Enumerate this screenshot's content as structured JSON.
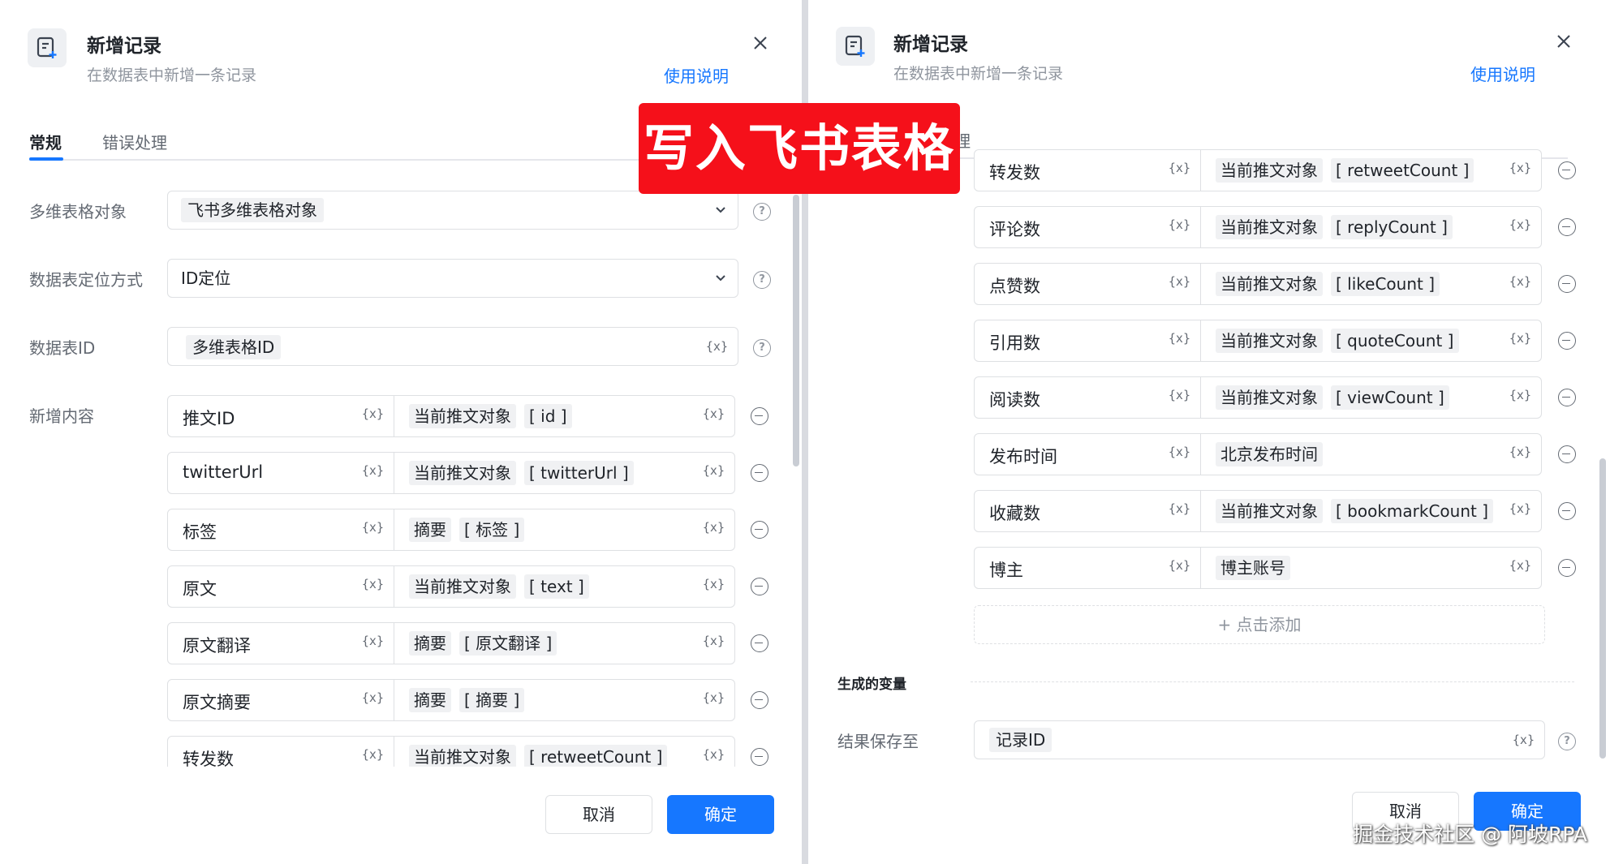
{
  "left": {
    "title": "新增记录",
    "subtitle": "在数据表中新增一条记录",
    "help_link": "使用说明",
    "tabs": [
      {
        "label": "常规"
      },
      {
        "label": "错误处理"
      }
    ],
    "fields": {
      "table_object": {
        "label": "多维表格对象",
        "value": "飞书多维表格对象"
      },
      "locate_method": {
        "label": "数据表定位方式",
        "value": "ID定位"
      },
      "table_id": {
        "label": "数据表ID",
        "value": "多维表格ID"
      },
      "new_content": {
        "label": "新增内容"
      }
    },
    "rows": [
      {
        "name": "推文ID",
        "source": "当前推文对象",
        "key": "id"
      },
      {
        "name": "twitterUrl",
        "source": "当前推文对象",
        "key": "twitterUrl"
      },
      {
        "name": "标签",
        "source": "摘要",
        "key": "标签"
      },
      {
        "name": "原文",
        "source": "当前推文对象",
        "key": "text"
      },
      {
        "name": "原文翻译",
        "source": "摘要",
        "key": "原文翻译"
      },
      {
        "name": "原文摘要",
        "source": "摘要",
        "key": "摘要"
      },
      {
        "name": "转发数",
        "source": "当前推文对象",
        "key": "retweetCount"
      }
    ],
    "cancel": "取消",
    "ok": "确定"
  },
  "right": {
    "title": "新增记录",
    "subtitle": "在数据表中新增一条记录",
    "help_link": "使用说明",
    "tab_partial": "理",
    "rows": [
      {
        "name": "转发数",
        "source": "当前推文对象",
        "key": "retweetCount"
      },
      {
        "name": "评论数",
        "source": "当前推文对象",
        "key": "replyCount"
      },
      {
        "name": "点赞数",
        "source": "当前推文对象",
        "key": "likeCount"
      },
      {
        "name": "引用数",
        "source": "当前推文对象",
        "key": "quoteCount"
      },
      {
        "name": "阅读数",
        "source": "当前推文对象",
        "key": "viewCount"
      },
      {
        "name": "发布时间",
        "source": "北京发布时间",
        "key": ""
      },
      {
        "name": "收藏数",
        "source": "当前推文对象",
        "key": "bookmarkCount"
      },
      {
        "name": "博主",
        "source": "博主账号",
        "key": ""
      }
    ],
    "add_label": "+ 点击添加",
    "section_title": "生成的变量",
    "result_label": "结果保存至",
    "result_value": "记录ID",
    "cancel": "取消",
    "ok": "确定"
  },
  "banner": "写入飞书表格",
  "watermark": "掘金技术社区 @ 阿坡RPA",
  "var_symbol": "{x}",
  "help_symbol": "?",
  "colors": {
    "accent": "#1677ff",
    "banner": "#f5101a"
  }
}
